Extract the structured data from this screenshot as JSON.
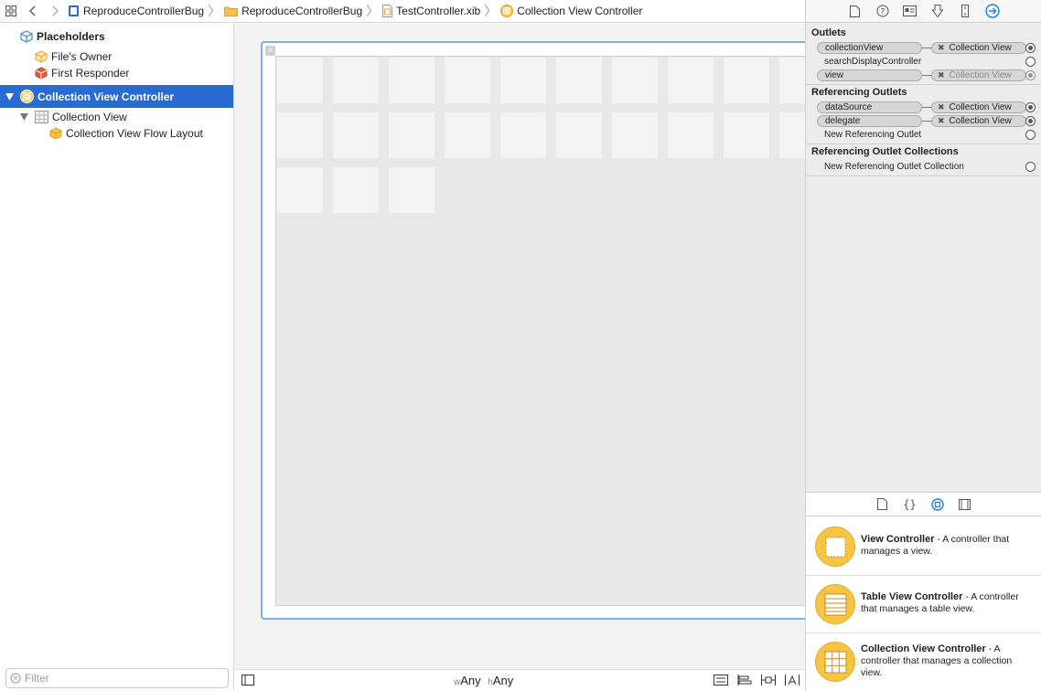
{
  "jumpbar": {
    "crumbs": [
      "ReproduceControllerBug",
      "ReproduceControllerBug",
      "TestController.xib",
      "Collection View Controller"
    ]
  },
  "outline": {
    "placeholders_label": "Placeholders",
    "files_owner": "File's Owner",
    "first_responder": "First Responder",
    "cvc": "Collection View Controller",
    "collection_view": "Collection View",
    "flow_layout": "Collection View Flow Layout",
    "filter_placeholder": "Filter"
  },
  "canvas": {
    "size_w_prefix": "w",
    "size_w": "Any",
    "size_h_prefix": "h",
    "size_h": "Any"
  },
  "inspector": {
    "outlets_title": "Outlets",
    "outlets": [
      {
        "name": "collectionView",
        "dest": "Collection View",
        "connected": true
      },
      {
        "name": "searchDisplayController",
        "dest": "",
        "connected": false
      },
      {
        "name": "view",
        "dest": "Collection View",
        "connected": true,
        "dim": true
      }
    ],
    "ref_title": "Referencing Outlets",
    "ref_outlets": [
      {
        "name": "dataSource",
        "dest": "Collection View",
        "connected": true
      },
      {
        "name": "delegate",
        "dest": "Collection View",
        "connected": true
      }
    ],
    "new_ref": "New Referencing Outlet",
    "coll_title": "Referencing Outlet Collections",
    "new_coll": "New Referencing Outlet Collection"
  },
  "library": {
    "items": [
      {
        "title": "View Controller",
        "desc": " - A controller that manages a view."
      },
      {
        "title": "Table View Controller",
        "desc": " - A controller that manages a table view."
      },
      {
        "title": "Collection View Controller",
        "desc": " - A controller that manages a collection view."
      }
    ]
  },
  "colors": {
    "selection": "#2a6bd3",
    "accent": "#1d7cf2",
    "library_icon": "#f7c443"
  }
}
